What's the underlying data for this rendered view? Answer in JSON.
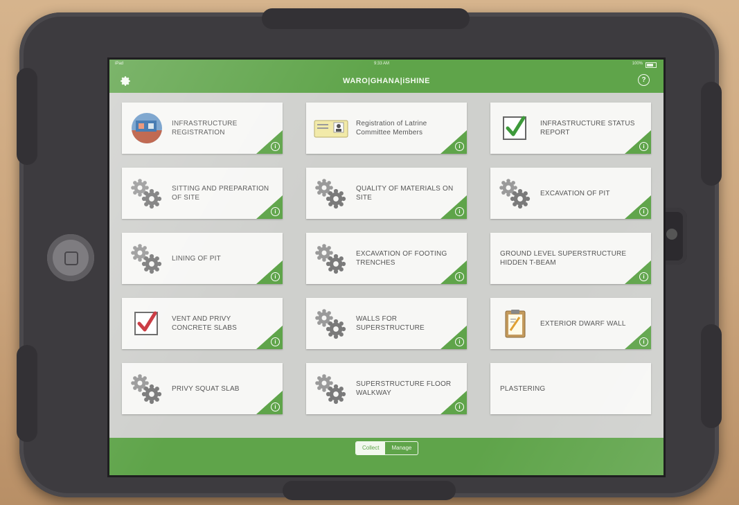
{
  "status_bar": {
    "carrier": "iPad",
    "time": "9:33 AM",
    "battery": "100%"
  },
  "header": {
    "title": "WARO|GHANA|iSHINE",
    "help_glyph": "?"
  },
  "tiles": [
    {
      "label": "INFRASTRUCTURE REGISTRATION",
      "icon": "building-photo-icon"
    },
    {
      "label": "Registration of Latrine Committee Members",
      "icon": "id-card-icon"
    },
    {
      "label": "INFRASTRUCTURE STATUS REPORT",
      "icon": "green-checkbox-icon"
    },
    {
      "label": "SITTING AND PREPARATION OF SITE",
      "icon": "gears-icon"
    },
    {
      "label": "QUALITY OF MATERIALS ON SITE",
      "icon": "gears-icon"
    },
    {
      "label": "EXCAVATION OF PIT",
      "icon": "gears-icon"
    },
    {
      "label": "LINING OF PIT",
      "icon": "gears-icon"
    },
    {
      "label": "EXCAVATION OF FOOTING TRENCHES",
      "icon": "gears-icon"
    },
    {
      "label": "GROUND LEVEL SUPERSTRUCTURE HIDDEN T-BEAM",
      "icon": "none"
    },
    {
      "label": "VENT AND PRIVY CONCRETE SLABS",
      "icon": "red-checkbox-icon"
    },
    {
      "label": "WALLS FOR SUPERSTRUCTURE",
      "icon": "gears-icon"
    },
    {
      "label": "EXTERIOR DWARF WALL",
      "icon": "clipboard-icon"
    },
    {
      "label": "PRIVY SQUAT SLAB",
      "icon": "gears-icon"
    },
    {
      "label": "SUPERSTRUCTURE FLOOR WALKWAY",
      "icon": "gears-icon"
    },
    {
      "label": "PLASTERING",
      "icon": "none"
    }
  ],
  "info_glyph": "i",
  "bottom": {
    "collect_label": "Collect",
    "manage_label": "Manage",
    "selected": "Manage"
  },
  "colors": {
    "accent": "#5fa44a",
    "tile_bg": "#f7f7f5",
    "screen_bg": "#cfd0cd"
  }
}
